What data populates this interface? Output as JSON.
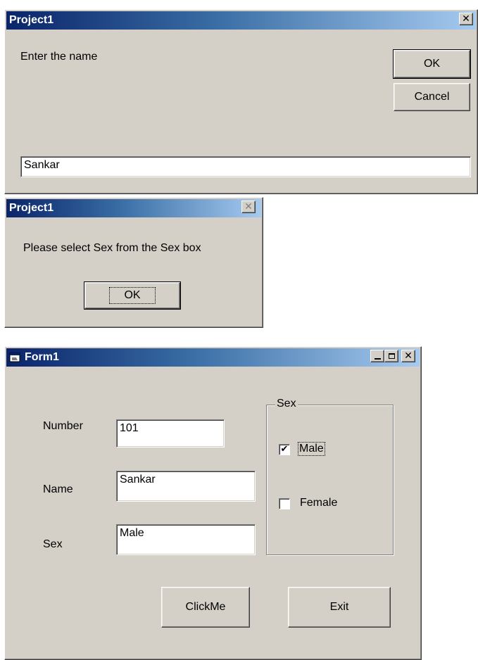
{
  "input_dialog": {
    "title": "Project1",
    "prompt": "Enter the name",
    "ok_label": "OK",
    "cancel_label": "Cancel",
    "input_value": "Sankar"
  },
  "message_dialog": {
    "title": "Project1",
    "message": "Please select Sex from the Sex box",
    "ok_label": "OK"
  },
  "form1": {
    "title": "Form1",
    "number_label": "Number",
    "number_value": "101",
    "name_label": "Name",
    "name_value": "Sankar",
    "sex_label": "Sex",
    "sex_value": "Male",
    "sex_group": {
      "legend": "Sex",
      "male_label": "Male",
      "male_checked": true,
      "female_label": "Female",
      "female_checked": false
    },
    "clickme_label": "ClickMe",
    "exit_label": "Exit"
  },
  "icons": [
    "close-icon",
    "minimize-icon",
    "maximize-icon",
    "form-app-icon",
    "checkmark-icon"
  ]
}
